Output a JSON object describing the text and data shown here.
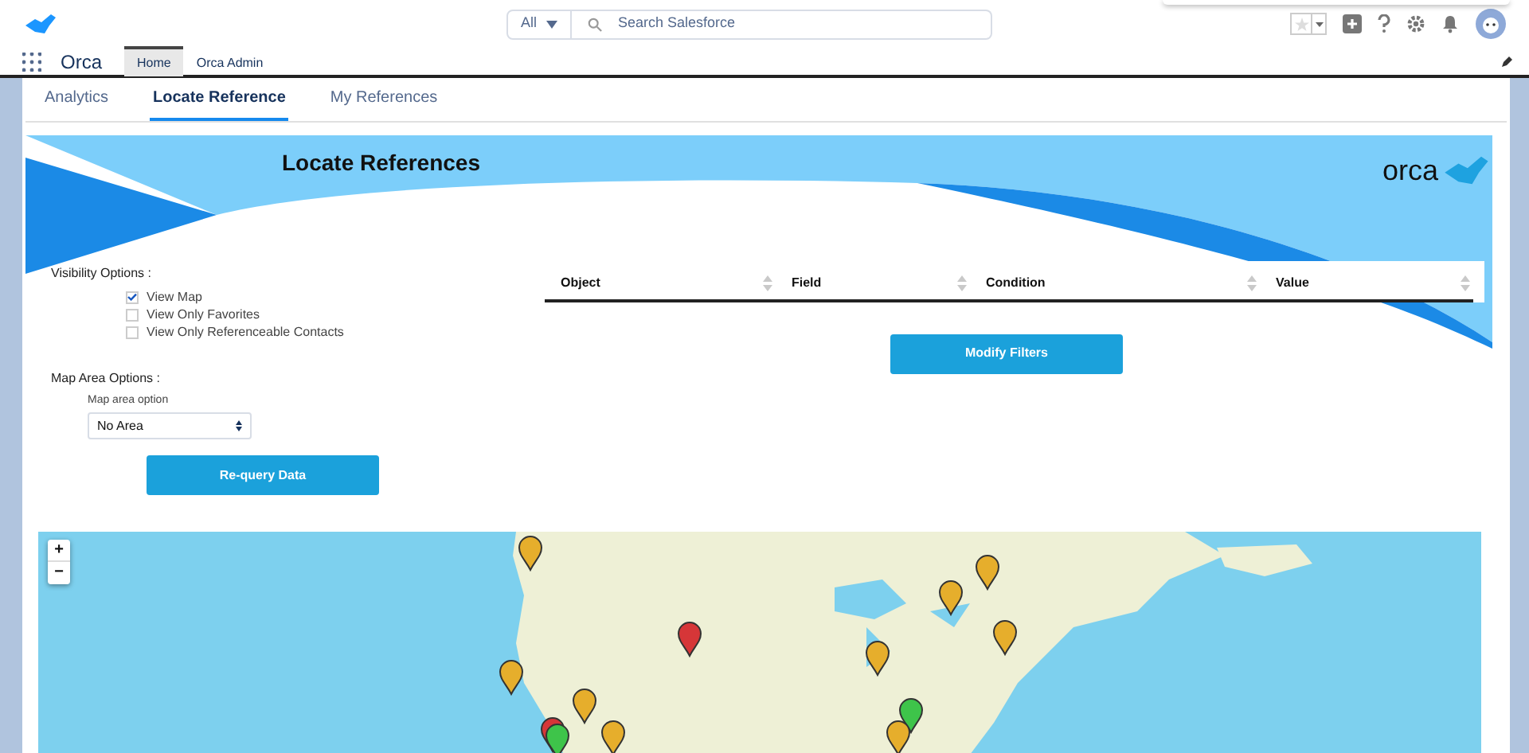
{
  "app_bar": {
    "search_scope": "All",
    "search": {
      "placeholder": "Search Salesforce"
    }
  },
  "nav": {
    "app_name": "Orca",
    "items": [
      {
        "label": "Home",
        "selected": true
      },
      {
        "label": "Orca Admin",
        "selected": false
      }
    ]
  },
  "tabs": [
    {
      "label": "Analytics",
      "selected": false
    },
    {
      "label": "Locate Reference",
      "selected": true
    },
    {
      "label": "My References",
      "selected": false
    }
  ],
  "banner": {
    "title": "Locate References",
    "logo_text": "orca"
  },
  "visibility": {
    "label": "Visibility Options :",
    "options": [
      {
        "label": "View Map",
        "checked": true
      },
      {
        "label": "View Only Favorites",
        "checked": false
      },
      {
        "label": "View Only Referenceable Contacts",
        "checked": false
      }
    ]
  },
  "map_area": {
    "label": "Map Area Options :",
    "field_label": "Map area option",
    "value": "No Area"
  },
  "requery_button": "Re-query Data",
  "filter_table": {
    "columns": [
      "Object",
      "Field",
      "Condition",
      "Value"
    ]
  },
  "modify_button": "Modify Filters",
  "map": {
    "zoom_in": "+",
    "zoom_out": "−"
  }
}
